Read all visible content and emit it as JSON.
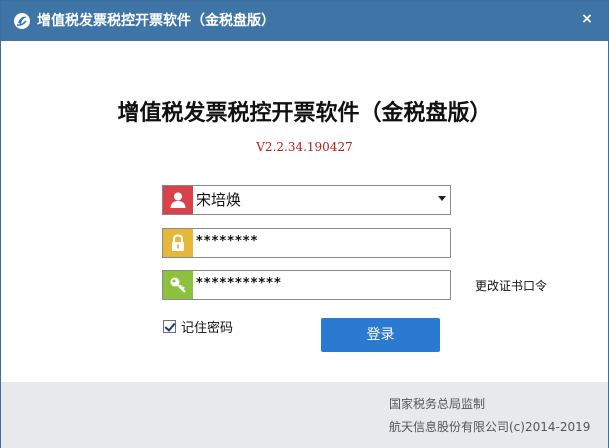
{
  "window": {
    "title": "增值税发票税控开票软件（金税盘版）",
    "close_glyph": "×"
  },
  "header": {
    "main_title": "增值税发票税控开票软件（金税盘版）",
    "version": "V2.2.34.190427"
  },
  "form": {
    "user": {
      "value": "宋培焕",
      "icon": "user-icon"
    },
    "password": {
      "value": "********",
      "icon": "lock-icon"
    },
    "cert_password": {
      "value": "***********",
      "icon": "key-icon"
    },
    "change_cert_label": "更改证书口令",
    "remember": {
      "label": "记住密码",
      "checked": true
    },
    "login_label": "登录"
  },
  "footer": {
    "line1": "国家税务总局监制",
    "line2": "航天信息股份有限公司(c)2014-2019"
  },
  "colors": {
    "titlebar": "#3f75a6",
    "user_icon_bg": "#d8424a",
    "lock_icon_bg": "#e6b73a",
    "key_icon_bg": "#8dc23f",
    "login_button": "#2a7ad2",
    "version_text": "#b22020"
  }
}
